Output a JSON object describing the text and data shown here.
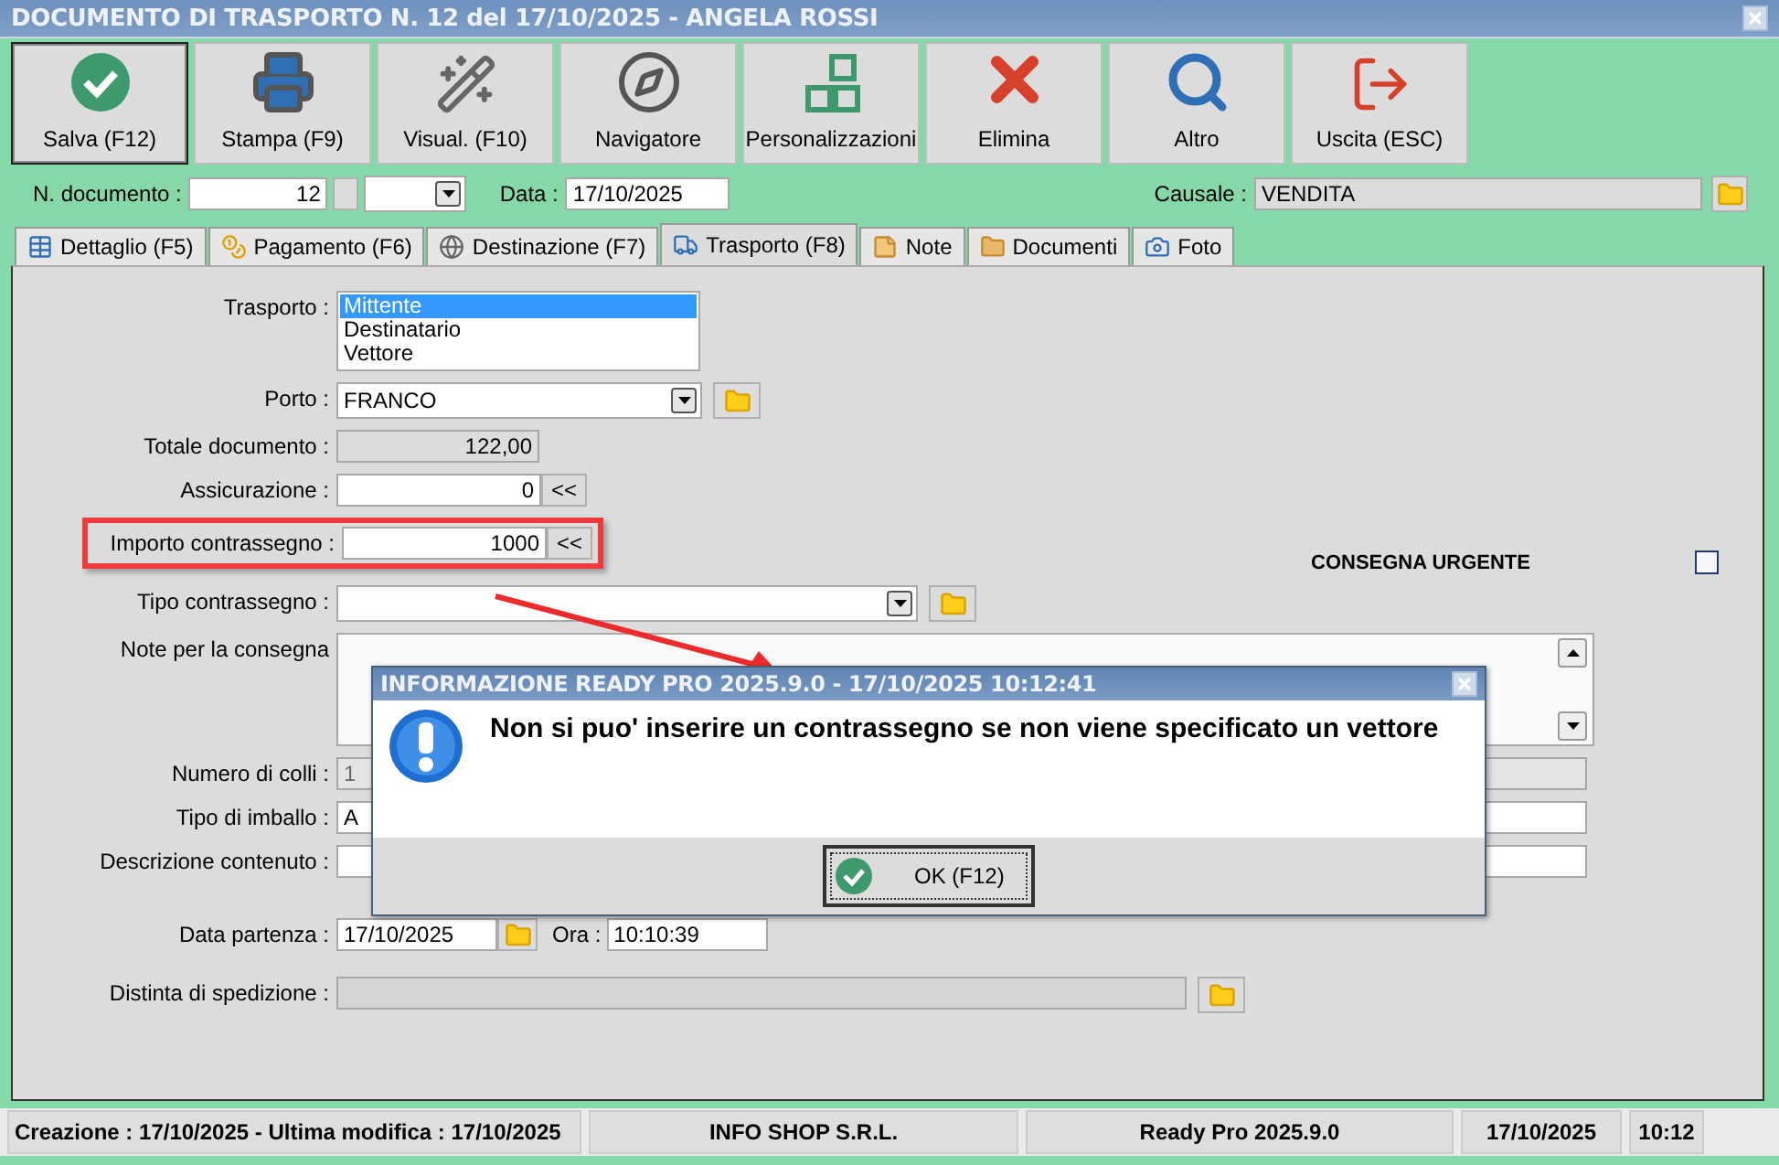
{
  "window": {
    "title": "DOCUMENTO DI TRASPORTO N. 12 del 17/10/2025 - ANGELA ROSSI"
  },
  "toolbar": [
    {
      "label": "Salva (F12)",
      "kind": "save",
      "focused": true
    },
    {
      "label": "Stampa (F9)",
      "kind": "print",
      "focused": false
    },
    {
      "label": "Visual. (F10)",
      "kind": "wand",
      "focused": false
    },
    {
      "label": "Navigatore",
      "kind": "compass",
      "focused": false
    },
    {
      "label": "Personalizzazioni",
      "kind": "squares",
      "focused": false
    },
    {
      "label": "Elimina",
      "kind": "delete",
      "focused": false
    },
    {
      "label": "Altro",
      "kind": "search",
      "focused": false
    },
    {
      "label": "Uscita (ESC)",
      "kind": "exit",
      "focused": false
    }
  ],
  "header": {
    "number_label": "N. documento :",
    "number": "12",
    "date_label": "Data :",
    "date": "17/10/2025",
    "reason_label": "Causale :",
    "reason": "VENDITA"
  },
  "tabs": [
    {
      "label": "Dettaglio (F5)",
      "kind": "table",
      "selected": false
    },
    {
      "label": "Pagamento (F6)",
      "kind": "coins",
      "selected": false
    },
    {
      "label": "Destinazione (F7)",
      "kind": "globe",
      "selected": false
    },
    {
      "label": "Trasporto (F8)",
      "kind": "truck",
      "selected": true
    },
    {
      "label": "Note",
      "kind": "note",
      "selected": false
    },
    {
      "label": "Documenti",
      "kind": "folder",
      "selected": false
    },
    {
      "label": "Foto",
      "kind": "camera",
      "selected": false
    }
  ],
  "form": {
    "rows": [
      {
        "kind": "list",
        "label": "Trasporto :",
        "options": [
          {
            "label": "Mittente",
            "selected": true
          },
          {
            "label": "Destinatario",
            "selected": false
          },
          {
            "label": "Vettore",
            "selected": false
          }
        ]
      },
      {
        "kind": "combo",
        "label": "Porto :",
        "value": "FRANCO"
      },
      {
        "kind": "readonly",
        "label": "Totale documento :",
        "value": "122,00"
      },
      {
        "kind": "amount",
        "label": "Assicurazione :",
        "value": "0",
        "button": "<<",
        "highlighted": false
      },
      {
        "kind": "amount",
        "label": "Importo contrassegno :",
        "value": "1000",
        "button": "<<",
        "highlighted": true,
        "aside": {
          "label": "CONSEGNA URGENTE",
          "checked": false
        }
      },
      {
        "kind": "wide-combo",
        "label": "Tipo contrassegno :"
      },
      {
        "kind": "textarea",
        "label": "Note per la consegna"
      },
      {
        "kind": "text",
        "label": "Numero di colli :",
        "value": "1",
        "disabled": true
      },
      {
        "kind": "text",
        "label": "Tipo di imballo :",
        "value": "A",
        "disabled": false
      },
      {
        "kind": "text",
        "label": "Descrizione contenuto :",
        "disabled": false
      },
      {
        "kind": "date",
        "label": "Data partenza :",
        "value": "17/10/2025",
        "time_label": "Ora :",
        "time": "10:10:39"
      },
      {
        "kind": "wide-readonly",
        "label": "Distinta di spedizione :"
      }
    ]
  },
  "dialog": {
    "title": "INFORMAZIONE READY PRO 2025.9.0 - 17/10/2025 10:12:41",
    "message": "Non si puo' inserire un contrassegno se non viene specificato un vettore",
    "button": "OK (F12)"
  },
  "status_bar": [
    "Creazione : 17/10/2025 - Ultima modifica : 17/10/2025",
    "INFO SHOP S.R.L.",
    "Ready Pro 2025.9.0",
    "17/10/2025",
    "10:12"
  ]
}
